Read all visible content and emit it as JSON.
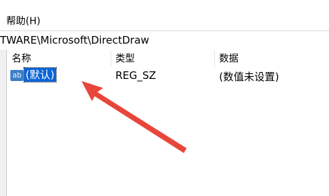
{
  "menubar": {
    "help_label": "帮助(H)"
  },
  "address": {
    "path": "TWARE\\Microsoft\\DirectDraw"
  },
  "columns": {
    "name": "名称",
    "type": "类型",
    "data": "数据"
  },
  "rows": [
    {
      "icon": "string-value-icon",
      "icon_text": "ab",
      "name": "(默认)",
      "type": "REG_SZ",
      "data": "(数值未设置)"
    }
  ],
  "colors": {
    "selection": "#0a64d8",
    "annotation_arrow": "#e8463a"
  }
}
